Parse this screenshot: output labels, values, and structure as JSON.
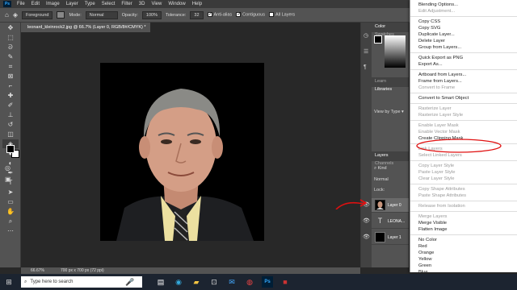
{
  "app": {
    "logo": "Ps",
    "menu": [
      "File",
      "Edit",
      "Image",
      "Layer",
      "Type",
      "Select",
      "Filter",
      "3D",
      "View",
      "Window",
      "Help"
    ]
  },
  "options_bar": {
    "layer_source": "Foreground",
    "mode_label": "Mode:",
    "mode_value": "Normal",
    "opacity_label": "Opacity:",
    "opacity_value": "100%",
    "tolerance_label": "Tolerance:",
    "tolerance_value": "32",
    "anti_alias": "Anti-alias",
    "contiguous": "Contiguous",
    "all_layers": "All Layers"
  },
  "document": {
    "tab_title": "leonard_kleinrock2.jpg @ 66.7% (Layer 0, RGB/8#/CMYK) *",
    "zoom": "66.67%",
    "doc_info": "700 px x 700 px (72 ppi)"
  },
  "panels": {
    "color_tab": "Color",
    "swatches_tab": "Swatches",
    "learn_tab": "Learn",
    "libraries_tab": "Libraries",
    "view_by_type": "View by Type",
    "layers_tab": "Layers",
    "channels_tab": "Channels",
    "kind_label": "Kind",
    "blend_mode": "Normal",
    "lock_label": "Lock:",
    "layers": [
      {
        "name": "Layer 0",
        "type": "image"
      },
      {
        "name": "LEONA...",
        "type": "text"
      },
      {
        "name": "Layer 1",
        "type": "fill"
      }
    ]
  },
  "context_menu": {
    "items": [
      {
        "label": "Blending Options...",
        "disabled": false,
        "group": 1
      },
      {
        "label": "Edit Adjustment...",
        "disabled": true,
        "group": 1
      },
      {
        "label": "Copy CSS",
        "disabled": false,
        "group": 2
      },
      {
        "label": "Copy SVG",
        "disabled": false,
        "group": 2
      },
      {
        "label": "Duplicate Layer...",
        "disabled": false,
        "group": 2
      },
      {
        "label": "Delete Layer",
        "disabled": false,
        "group": 2
      },
      {
        "label": "Group from Layers...",
        "disabled": false,
        "group": 2
      },
      {
        "label": "Quick Export as PNG",
        "disabled": false,
        "group": 3
      },
      {
        "label": "Export As...",
        "disabled": false,
        "group": 3
      },
      {
        "label": "Artboard from Layers...",
        "disabled": false,
        "group": 4
      },
      {
        "label": "Frame from Layers...",
        "disabled": false,
        "group": 4
      },
      {
        "label": "Convert to Frame",
        "disabled": true,
        "group": 4
      },
      {
        "label": "Convert to Smart Object",
        "disabled": false,
        "group": 5
      },
      {
        "label": "Rasterize Layer",
        "disabled": true,
        "group": 6
      },
      {
        "label": "Rasterize Layer Style",
        "disabled": true,
        "group": 6
      },
      {
        "label": "Enable Layer Mask",
        "disabled": true,
        "group": 7
      },
      {
        "label": "Enable Vector Mask",
        "disabled": true,
        "group": 7
      },
      {
        "label": "Create Clipping Mask",
        "disabled": false,
        "group": 7
      },
      {
        "label": "Link Layers",
        "disabled": true,
        "group": 8
      },
      {
        "label": "Select Linked Layers",
        "disabled": true,
        "group": 8
      },
      {
        "label": "Copy Layer Style",
        "disabled": true,
        "group": 9
      },
      {
        "label": "Paste Layer Style",
        "disabled": true,
        "group": 9
      },
      {
        "label": "Clear Layer Style",
        "disabled": true,
        "group": 9
      },
      {
        "label": "Copy Shape Attributes",
        "disabled": true,
        "group": 10
      },
      {
        "label": "Paste Shape Attributes",
        "disabled": true,
        "group": 10
      },
      {
        "label": "Release from Isolation",
        "disabled": true,
        "group": 11
      },
      {
        "label": "Merge Layers",
        "disabled": true,
        "group": 12
      },
      {
        "label": "Merge Visible",
        "disabled": false,
        "group": 12
      },
      {
        "label": "Flatten Image",
        "disabled": false,
        "group": 12
      },
      {
        "label": "No Color",
        "disabled": false,
        "group": 13
      },
      {
        "label": "Red",
        "disabled": false,
        "group": 13
      },
      {
        "label": "Orange",
        "disabled": false,
        "group": 13
      },
      {
        "label": "Yellow",
        "disabled": false,
        "group": 13
      },
      {
        "label": "Green",
        "disabled": false,
        "group": 13
      },
      {
        "label": "Blue",
        "disabled": false,
        "group": 13
      }
    ]
  },
  "taskbar": {
    "search_placeholder": "Type here to search"
  },
  "colors": {
    "annotation": "#e01010",
    "ui_dark": "#282828",
    "panel": "#535353"
  }
}
